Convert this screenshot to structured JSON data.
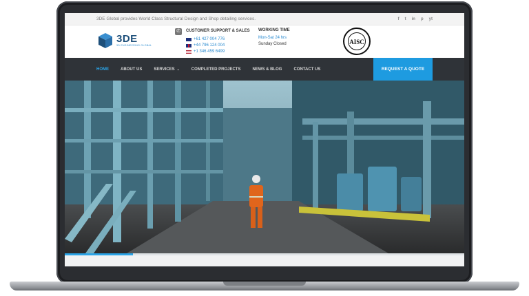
{
  "topbar": {
    "tagline": "3DE Global provides World Class Structural Design and Shop detailing services.",
    "socials": [
      "f",
      "t",
      "in",
      "p",
      "yt"
    ]
  },
  "header": {
    "logo_text": "3DE",
    "logo_subtext": "3D ENGINEERING GLOBAL",
    "support_title": "CUSTOMER SUPPORT & SALES",
    "phones": [
      "+61 427 004 776",
      "+44 796 124 004",
      "+1 346 459 6499"
    ],
    "hours_title": "WORKING TIME",
    "hours_days": "Mon-Sat 24 hrs",
    "hours_closed": "Sunday Closed",
    "seal_text": "AISC"
  },
  "nav": {
    "items": [
      "HOME",
      "ABOUT US",
      "SERVICES",
      "COMPLETED PROJECTS",
      "NEWS & BLOG",
      "CONTACT US"
    ],
    "quote_button": "REQUEST A QUOTE"
  },
  "hero": {
    "slider_progress": 0.17
  },
  "colors": {
    "accent": "#1e9be0",
    "nav_bg": "#2f3338",
    "logo": "#1d4f7a"
  },
  "icons": [
    "facebook-icon",
    "twitter-icon",
    "linkedin-icon",
    "pinterest-icon",
    "youtube-icon",
    "phone-icon",
    "cube-logo-icon",
    "chevron-down-icon"
  ]
}
